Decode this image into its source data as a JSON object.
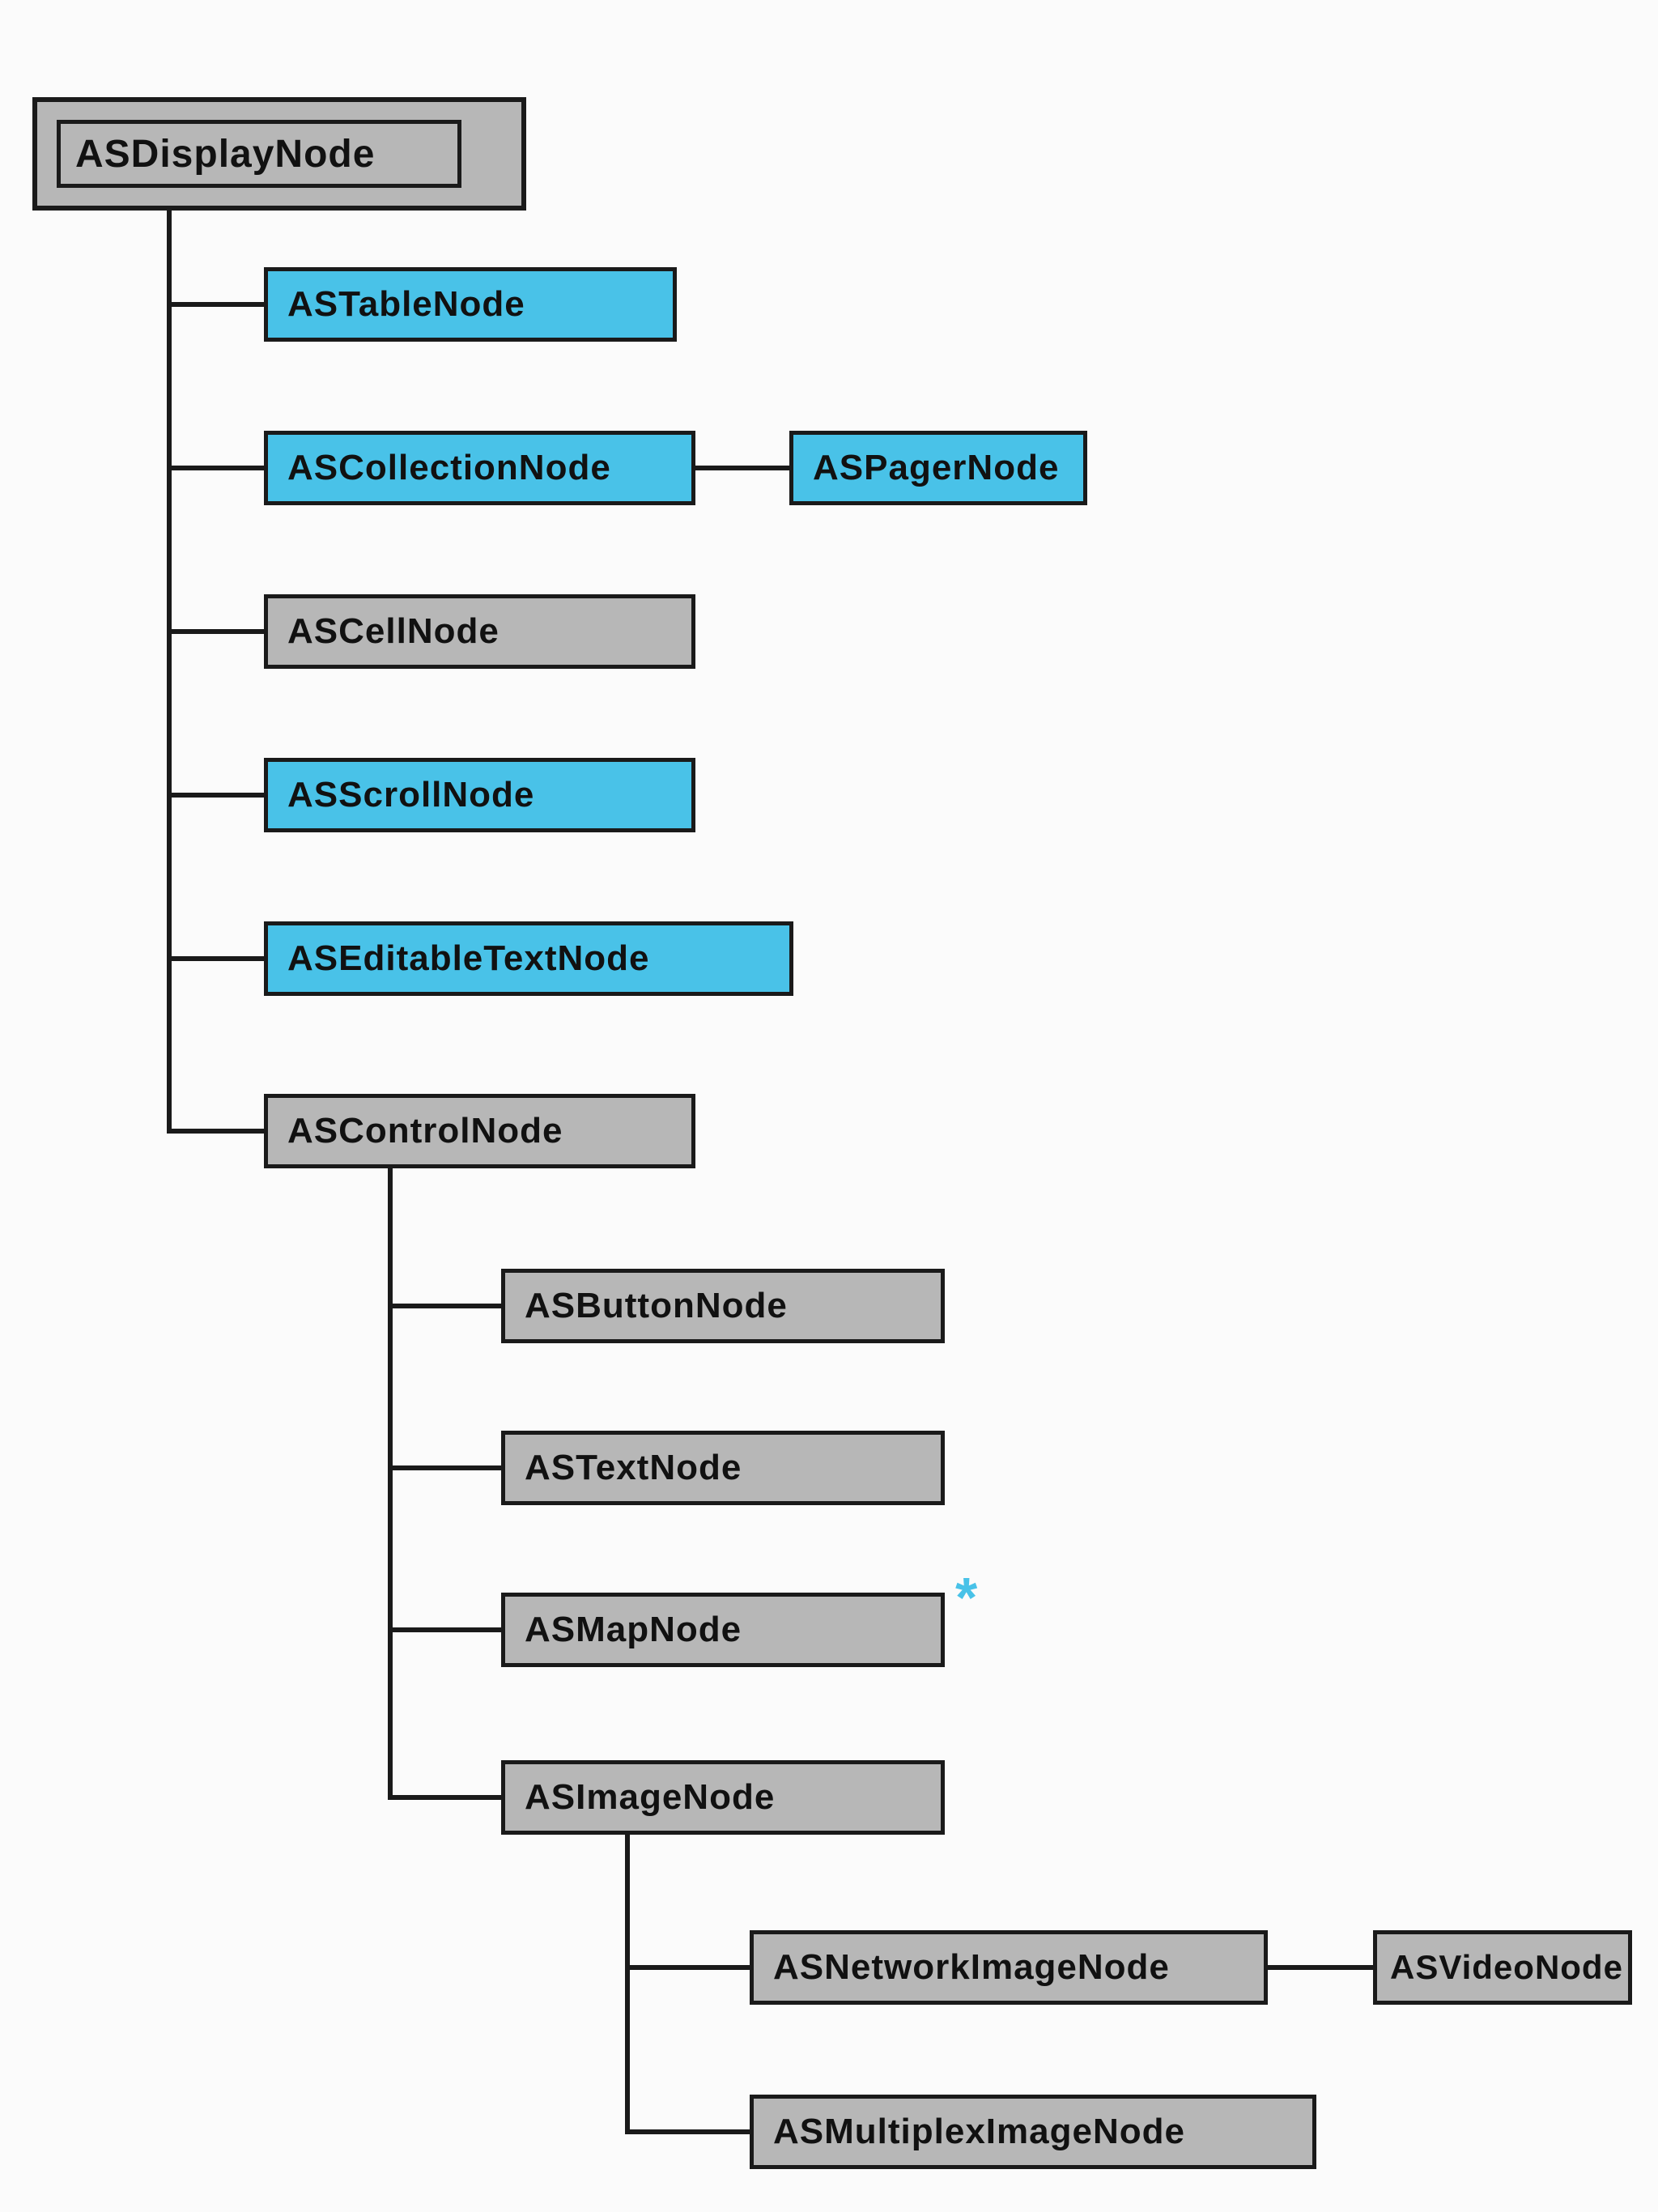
{
  "colors": {
    "gray": "#b7b7b7",
    "cyan": "#49c2e8",
    "line": "#1a1a1a"
  },
  "root": {
    "label": "ASDisplayNode"
  },
  "level1": {
    "table": {
      "label": "ASTableNode"
    },
    "collection": {
      "label": "ASCollectionNode"
    },
    "pager": {
      "label": "ASPagerNode"
    },
    "cell": {
      "label": "ASCellNode"
    },
    "scroll": {
      "label": "ASScrollNode"
    },
    "editable": {
      "label": "ASEditableTextNode"
    },
    "control": {
      "label": "ASControlNode"
    }
  },
  "level2": {
    "button": {
      "label": "ASButtonNode"
    },
    "text": {
      "label": "ASTextNode"
    },
    "map": {
      "label": "ASMapNode"
    },
    "image": {
      "label": "ASImageNode"
    }
  },
  "level3": {
    "network": {
      "label": "ASNetworkImageNode"
    },
    "video": {
      "label": "ASVideoNode"
    },
    "multiplex": {
      "label": "ASMultiplexImageNode"
    }
  },
  "annotation": {
    "star": "*"
  }
}
